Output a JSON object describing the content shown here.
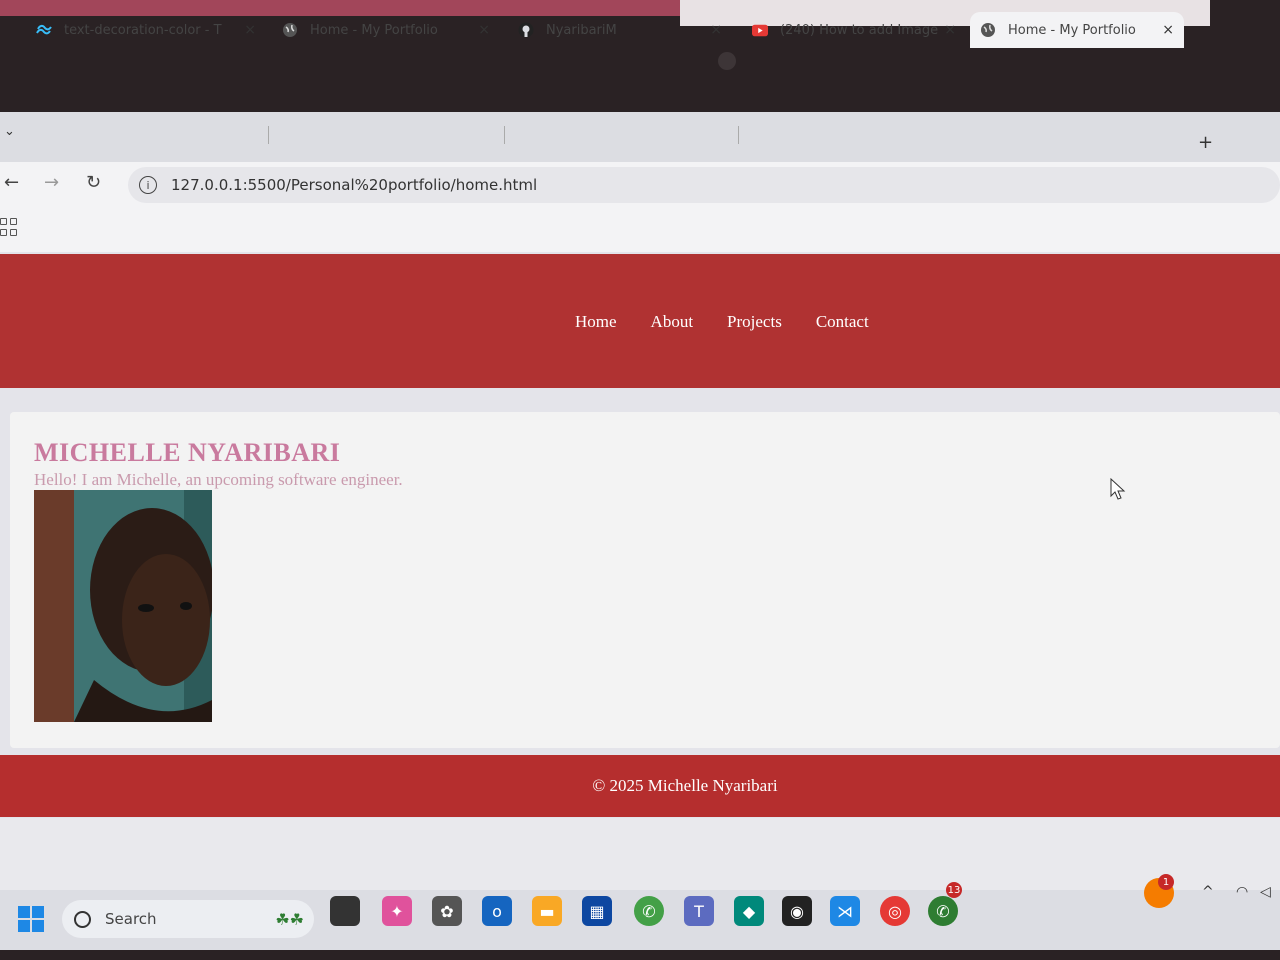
{
  "browser": {
    "tabs": [
      {
        "title": "text-decoration-color - T",
        "favicon": "tailwind-icon",
        "active": false
      },
      {
        "title": "Home - My Portfolio",
        "favicon": "globe-icon",
        "active": false
      },
      {
        "title": "NyaribariM",
        "favicon": "github-icon",
        "active": false
      },
      {
        "title": "(240) How to add Image",
        "favicon": "youtube-icon",
        "active": false
      },
      {
        "title": "Home - My Portfolio",
        "favicon": "globe-icon",
        "active": true
      }
    ],
    "close_glyph": "×",
    "new_tab_glyph": "+",
    "url": "127.0.0.1:5500/Personal%20portfolio/home.html"
  },
  "page": {
    "nav": [
      "Home",
      "About",
      "Projects",
      "Contact"
    ],
    "name": "MICHELLE NYARIBARI",
    "tagline": "Hello! I am Michelle, an upcoming software engineer.",
    "footer": "© 2025 Michelle Nyaribari"
  },
  "taskbar": {
    "search_label": "Search",
    "badges": {
      "whatsapp": "13",
      "notifications": "1"
    }
  },
  "colors": {
    "header": "#b03232",
    "footer": "#b52e2e",
    "name": "#c97a9e",
    "tagline": "#c99aad"
  }
}
